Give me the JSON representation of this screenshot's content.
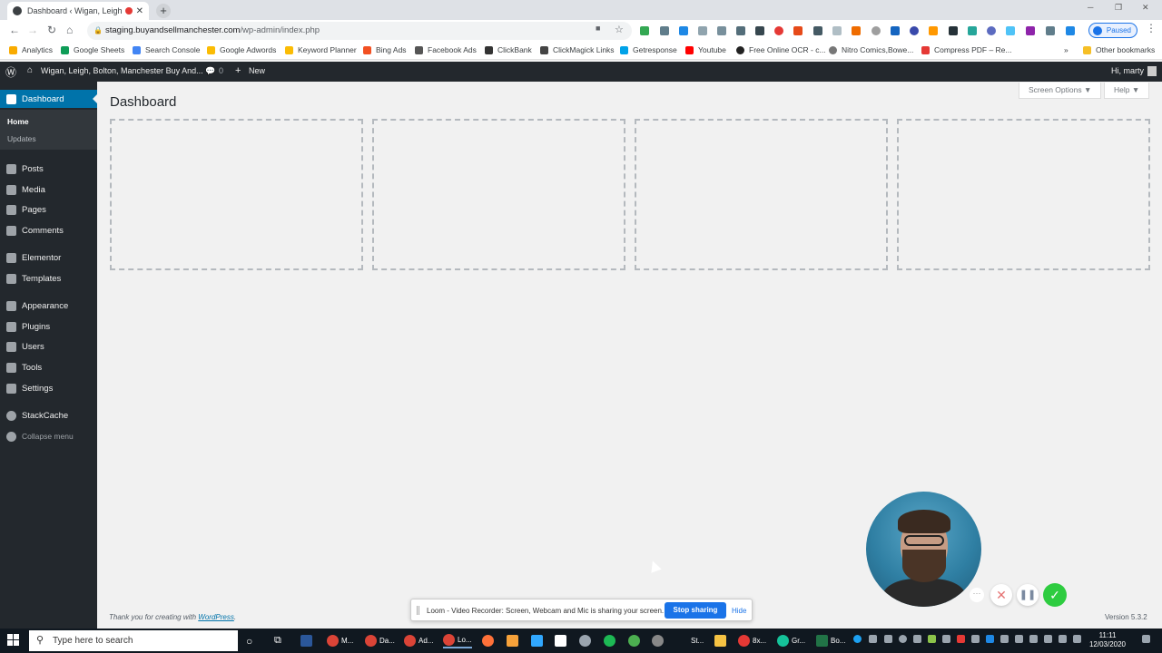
{
  "browser": {
    "tab_title": "Dashboard ‹ Wigan, Leigh, B...",
    "url_host": "staging.buyandsellmanchester.com",
    "url_path": "/wp-admin/index.php",
    "profile_status": "Paused",
    "bookmarks": [
      "Analytics",
      "Google Sheets",
      "Search Console",
      "Google Adwords",
      "Keyword Planner",
      "Bing Ads",
      "Facebook Ads",
      "ClickBank",
      "ClickMagick Links",
      "Getresponse",
      "Youtube",
      "Free Online OCR - c...",
      "Nitro Comics,Bowe...",
      "Compress PDF – Re..."
    ],
    "bookmarks_overflow": "»",
    "other_bookmarks": "Other bookmarks"
  },
  "adminbar": {
    "site_name": "Wigan, Leigh, Bolton, Manchester Buy And...",
    "comments_count": "0",
    "new_label": "New",
    "greeting": "Hi, marty"
  },
  "sidebar": {
    "dashboard": "Dashboard",
    "submenu": [
      "Home",
      "Updates"
    ],
    "items": [
      "Posts",
      "Media",
      "Pages",
      "Comments",
      "Elementor",
      "Templates",
      "Appearance",
      "Plugins",
      "Users",
      "Tools",
      "Settings",
      "StackCache",
      "Collapse menu"
    ]
  },
  "main": {
    "title": "Dashboard",
    "screen_options": "Screen Options ▼",
    "help": "Help ▼",
    "footer_thanks_prefix": "Thank you for creating with ",
    "footer_thanks_link": "WordPress",
    "footer_thanks_suffix": ".",
    "version": "Version 5.3.2"
  },
  "loom": {
    "message": "Loom - Video Recorder: Screen, Webcam and Mic is sharing your screen.",
    "stop_label": "Stop sharing",
    "hide_label": "Hide"
  },
  "taskbar": {
    "search_placeholder": "Type here to search",
    "apps": [
      "M...",
      "Da...",
      "Ad...",
      "Lo...",
      "St...",
      "8x...",
      "Gr...",
      "Bo..."
    ],
    "time": "11:11",
    "date": "12/03/2020"
  },
  "colors": {
    "wp_admin_dark": "#23282d",
    "wp_accent": "#0073aa",
    "loom_blue": "#1a73e8",
    "loom_done_green": "#2ecc40"
  }
}
